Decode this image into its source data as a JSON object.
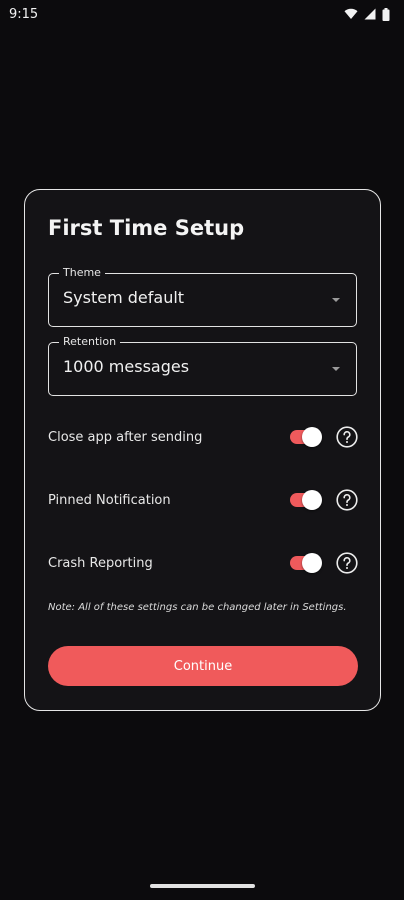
{
  "status_bar": {
    "time": "9:15",
    "icons": [
      "wifi-icon",
      "signal-icon",
      "battery-icon"
    ]
  },
  "dialog": {
    "title": "First Time Setup",
    "fields": [
      {
        "label": "Theme",
        "value": "System default"
      },
      {
        "label": "Retention",
        "value": "1000 messages"
      }
    ],
    "settings": [
      {
        "label": "Close app after sending",
        "enabled": true
      },
      {
        "label": "Pinned Notification",
        "enabled": true
      },
      {
        "label": "Crash Reporting",
        "enabled": true
      }
    ],
    "note": "Note: All of these settings can be changed later in Settings.",
    "continue_label": "Continue"
  },
  "colors": {
    "background": "#0c0b0d",
    "dialog_background": "#141316",
    "accent": "#f05a5b",
    "text": "#ececec"
  }
}
